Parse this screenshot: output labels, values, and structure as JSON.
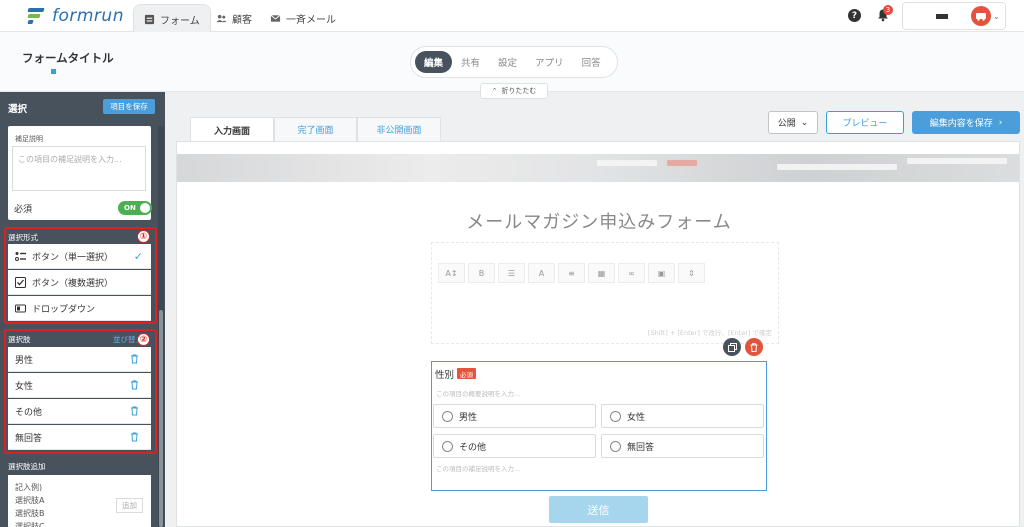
{
  "app": {
    "logo_text": "formrun"
  },
  "nav": {
    "tabs": [
      {
        "label": "フォーム",
        "icon": "form-icon",
        "active": true
      },
      {
        "label": "顧客",
        "icon": "users-icon",
        "active": false
      },
      {
        "label": "一斉メール",
        "icon": "mail-icon",
        "active": false
      }
    ],
    "help_label": "?",
    "notification_count": "3"
  },
  "secondary": {
    "form_title": "フォームタイトル",
    "modes": [
      "編集",
      "共有",
      "設定",
      "アプリ",
      "回答"
    ],
    "collapse_label": "折りたたむ"
  },
  "sidebar": {
    "title": "選択",
    "save_label": "項目を保存",
    "note_label": "補足説明",
    "note_placeholder": "この項目の補足説明を入力...",
    "required_label": "必須",
    "required_toggle": "ON",
    "format_label": "選択形式",
    "format_marker": "①",
    "formats": [
      {
        "label": "ボタン（単一選択）",
        "icon": "radio-list-icon",
        "checked": true
      },
      {
        "label": "ボタン（複数選択）",
        "icon": "checkbox-icon",
        "checked": false
      },
      {
        "label": "ドロップダウン",
        "icon": "dropdown-icon",
        "checked": false
      }
    ],
    "choices_label": "選択肢",
    "choices_marker": "②",
    "sort_label": "並び替え",
    "choices": [
      "男性",
      "女性",
      "その他",
      "無回答"
    ],
    "add_label": "選択肢追加",
    "add_example": "記入例)\n選択肢A\n選択肢B\n選択肢C",
    "add_button": "追加"
  },
  "page_tabs": [
    {
      "label": "入力画面",
      "active": true
    },
    {
      "label": "完了画面",
      "active": false
    },
    {
      "label": "非公開画面",
      "active": false
    }
  ],
  "actions": {
    "publish": "公開",
    "preview": "プレビュー",
    "save": "編集内容を保存"
  },
  "form": {
    "heading": "メールマガジン申込みフォーム",
    "editor_hint": "[Shift] + [Enter] で改行、[Enter] で確定",
    "toolbar": [
      "A↕",
      "B",
      "☰",
      "A",
      "≡",
      "▦",
      "∞",
      "▣",
      "⇕"
    ],
    "field": {
      "label": "性別",
      "required_badge": "必須",
      "description_placeholder": "この項目の概要説明を入力...",
      "options": [
        "男性",
        "女性",
        "その他",
        "無回答"
      ],
      "note_placeholder": "この項目の補足説明を入力..."
    },
    "submit_label": "送信"
  },
  "colors": {
    "accent": "#4b9ed9",
    "sidebar": "#47525d",
    "danger": "#e02020",
    "toggle": "#4caf50"
  }
}
